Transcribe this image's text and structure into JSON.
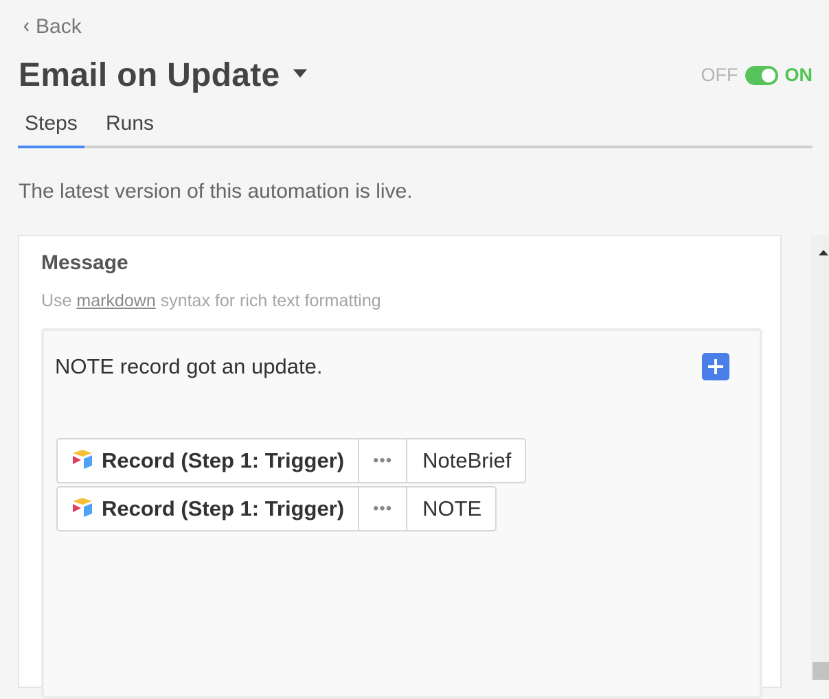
{
  "header": {
    "back_label": "Back",
    "title": "Email on Update",
    "toggle": {
      "off_label": "OFF",
      "on_label": "ON",
      "state": "on",
      "accent": "#56c45b"
    }
  },
  "tabs": [
    {
      "label": "Steps",
      "active": true
    },
    {
      "label": "Runs",
      "active": false
    }
  ],
  "status_text": "The latest version of this automation is live.",
  "message": {
    "label": "Message",
    "hint_prefix": "Use",
    "hint_link": "markdown",
    "hint_suffix": "syntax for rich text formatting",
    "body_text": "NOTE record got an update.",
    "tokens": [
      {
        "source": "Record (Step 1: Trigger)",
        "more": "•••",
        "field": "NoteBrief"
      },
      {
        "source": "Record (Step 1: Trigger)",
        "more": "•••",
        "field": "NOTE"
      }
    ]
  },
  "icons": {
    "back": "chevron-left-icon",
    "title_dropdown": "caret-down-icon",
    "add": "plus-icon",
    "token_source": "airtable-logo-icon"
  },
  "colors": {
    "tab_indicator": "#4a88f5",
    "add_button": "#4a7fea",
    "on_text": "#4cc552"
  }
}
